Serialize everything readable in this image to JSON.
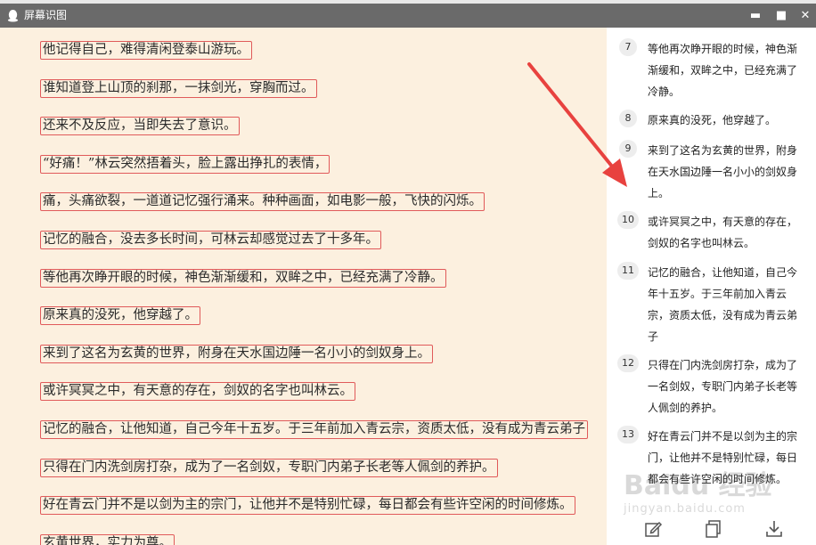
{
  "window": {
    "title": "屏幕识图",
    "controls": {
      "minimize": "▬",
      "maximize": "■",
      "close": "✕"
    }
  },
  "ocr_lines": [
    "他记得自己，难得清闲登泰山游玩。",
    "谁知道登上山顶的刹那，一抹剑光，穿胸而过。",
    "还来不及反应，当即失去了意识。",
    "“好痛！”林云突然捂着头，脸上露出挣扎的表情，",
    "痛，头痛欲裂，一道道记忆强行涌来。种种画面，如电影一般，飞快的闪烁。",
    "记忆的融合，没去多长时间，可林云却感觉过去了十多年。",
    "等他再次睁开眼的时候，神色渐渐缓和，双眸之中，已经充满了冷静。",
    "原来真的没死，他穿越了。",
    "来到了这名为玄黄的世界，附身在天水国边陲一名小小的剑奴身上。",
    "或许冥冥之中，有天意的存在，剑奴的名字也叫林云。",
    "记忆的融合，让他知道，自己今年十五岁。于三年前加入青云宗，资质太低，没有成为青云弟子",
    "只得在门内洗剑房打杂，成为了一名剑奴，专职门内弟子长老等人佩剑的养护。",
    "好在青云门并不是以剑为主的宗门，让他并不是特别忙碌，每日都会有些许空闲的时间修炼。",
    "玄黄世界，实力为尊。"
  ],
  "paragraphs": [
    {
      "num": "7",
      "text": "等他再次睁开眼的时候，神色渐渐缓和，双眸之中，已经充满了冷静。"
    },
    {
      "num": "8",
      "text": "原来真的没死，他穿越了。"
    },
    {
      "num": "9",
      "text": "来到了这名为玄黄的世界，附身在天水国边陲一名小小的剑奴身上。"
    },
    {
      "num": "10",
      "text": "或许冥冥之中，有天意的存在，剑奴的名字也叫林云。"
    },
    {
      "num": "11",
      "text": "记忆的融合，让他知道，自己今年十五岁。于三年前加入青云宗，资质太低，没有成为青云弟子"
    },
    {
      "num": "12",
      "text": "只得在门内洗剑房打杂，成为了一名剑奴，专职门内弟子长老等人佩剑的养护。"
    },
    {
      "num": "13",
      "text": "好在青云门并不是以剑为主的宗门，让他并不是特别忙碌，每日都会有些许空闲的时间修炼。"
    }
  ],
  "footer": {
    "icons": [
      "edit-icon",
      "copy-icon",
      "download-icon"
    ]
  },
  "watermark": {
    "main": "Baidu 经验",
    "sub": "jingyan.baidu.com"
  },
  "colors": {
    "titlebar": "#6a6a6a",
    "left_bg": "#fcf0df",
    "box_border": "#e05a5a",
    "arrow": "#e8423f"
  }
}
